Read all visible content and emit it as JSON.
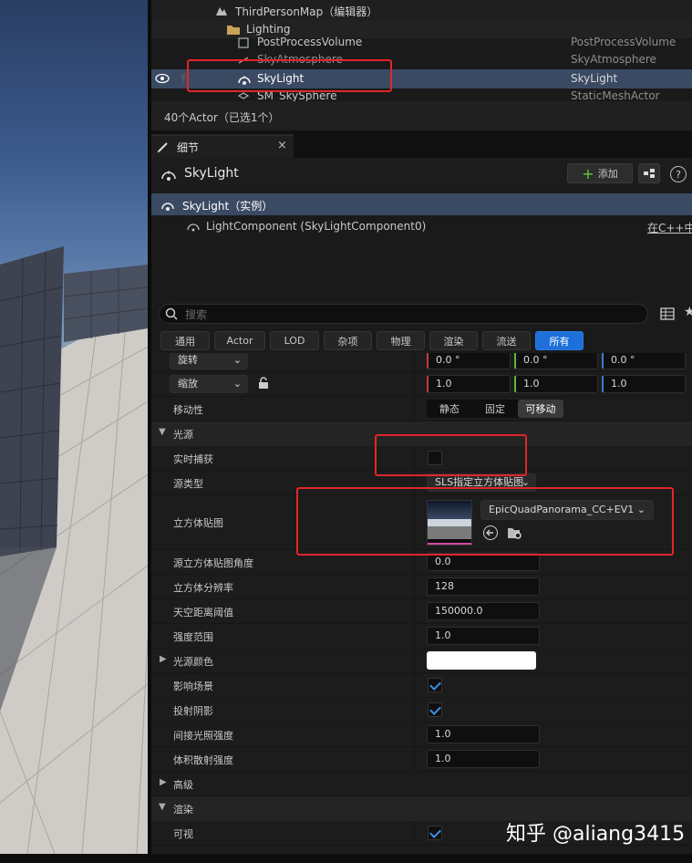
{
  "outliner": {
    "map_label": "ThirdPersonMap（编辑器）",
    "folder_label": "Lighting",
    "rows": [
      {
        "name": "PostProcessVolume",
        "type": "PostProcessVolume"
      },
      {
        "name": "SkyAtmosphere",
        "type": "SkyAtmosphere"
      },
      {
        "name": "SkyLight",
        "type": "SkyLight"
      },
      {
        "name": "SM_SkySphere",
        "type": "StaticMeshActor"
      }
    ],
    "status": "40个Actor（已选1个）"
  },
  "details": {
    "tab_label": "细节",
    "actor_name": "SkyLight",
    "add_label": "添加",
    "instance_label": "SkyLight（实例）",
    "component_label": "LightComponent (SkyLightComponent0)",
    "cpp_link": "在C++中",
    "search_placeholder": "搜索",
    "filters": [
      "通用",
      "Actor",
      "LOD",
      "杂项",
      "物理",
      "渲染",
      "流送",
      "所有"
    ],
    "transform": {
      "rotation_label": "旋转",
      "rotation": [
        "0.0 °",
        "0.0 °",
        "0.0 °"
      ],
      "scale_label": "缩放",
      "scale": [
        "1.0",
        "1.0",
        "1.0"
      ],
      "mobility_label": "移动性",
      "mobility_options": [
        "静态",
        "固定",
        "可移动"
      ],
      "mobility_selected": "可移动"
    },
    "light_category": "光源",
    "props": {
      "realtime_capture": "实时捕获",
      "source_type": "源类型",
      "source_type_value": "SLS指定立方体贴图",
      "cubemap": "立方体贴图",
      "cubemap_asset": "EpicQuadPanorama_CC+EV1",
      "cubemap_angle": "源立方体贴图角度",
      "cubemap_angle_value": "0.0",
      "cubemap_resolution": "立方体分辨率",
      "cubemap_resolution_value": "128",
      "sky_distance": "天空距离阈值",
      "sky_distance_value": "150000.0",
      "intensity_scale": "强度范围",
      "intensity_scale_value": "1.0",
      "light_color": "光源颜色",
      "affects_world": "影响场景",
      "cast_shadows": "投射阴影",
      "indirect_intensity": "间接光照强度",
      "indirect_intensity_value": "1.0",
      "volumetric_scattering": "体积散射强度",
      "volumetric_scattering_value": "1.0",
      "advanced": "高级"
    },
    "render_category": "渲染",
    "visible_label": "可视"
  },
  "watermark": "知乎 @aliang3415",
  "colors": {
    "accent": "#1e6fd9",
    "selection": "#3a4a63",
    "annotation_red": "#e0262a",
    "check_blue": "#3d8ee8"
  }
}
